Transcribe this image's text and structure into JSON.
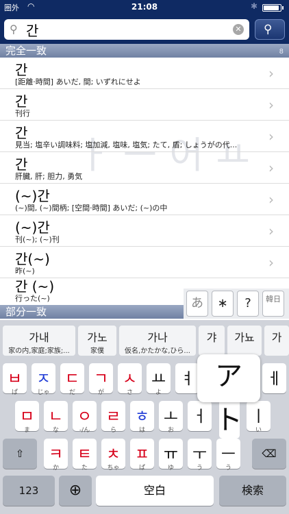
{
  "status": {
    "carrier": "圏外",
    "time": "21:08"
  },
  "search": {
    "value": "간"
  },
  "exact_section": {
    "label": "完全一致",
    "count": "8"
  },
  "partial_section": {
    "label": "部分一致"
  },
  "watermark": "ㅏㅡ어ㅛ",
  "results": [
    {
      "title": "간",
      "sub": "[距離·時間] あいだ, 間; いずれにせよ"
    },
    {
      "title": "간",
      "sub": "刊行"
    },
    {
      "title": "간",
      "sub": "見当; 塩辛い調味料; 塩加減, 塩味, 塩気; たて, 盾; しょうがの代..."
    },
    {
      "title": "간",
      "sub": "肝臓, 肝; 胆力, 勇気"
    },
    {
      "title": "(~)간",
      "sub": "(~)間, (~)間柄; [空間·時間] あいだ; (~)の中"
    },
    {
      "title": "(~)간",
      "sub": "刊(~); (~)刊"
    },
    {
      "title": "간(~)",
      "sub": "昨(~)"
    },
    {
      "title": "간 (~)",
      "sub": "行った(~)"
    }
  ],
  "candidates": [
    {
      "main": "가내",
      "sub": "家の内,家庭;家族;..."
    },
    {
      "main": "가노",
      "sub": "家僕"
    },
    {
      "main": "가나",
      "sub": "仮名,かたかな,ひら..."
    },
    {
      "main": "갸",
      "sub": ""
    },
    {
      "main": "가뇨",
      "sub": ""
    },
    {
      "main": "가",
      "sub": ""
    }
  ],
  "popup": {
    "a": "あ",
    "star": "∗",
    "q": "?",
    "hanja": "韓日",
    "big": "ア ト"
  },
  "keys": {
    "row1": [
      {
        "main": "ㅂ",
        "sub": "ぱ"
      },
      {
        "main": "ㅈ",
        "sub": "じゃ"
      },
      {
        "main": "ㄷ",
        "sub": "だ"
      },
      {
        "main": "ㄱ",
        "sub": "が"
      },
      {
        "main": "ㅅ",
        "sub": "さ"
      },
      {
        "main": "ㅛ",
        "sub": "よ"
      },
      {
        "main": "ㅕ",
        "sub": ""
      },
      {
        "main": "ㅔ",
        "sub": ""
      }
    ],
    "row2": [
      {
        "main": "ㅁ",
        "sub": "ま"
      },
      {
        "main": "ㄴ",
        "sub": "な"
      },
      {
        "main": "ㅇ",
        "sub": "-/ん"
      },
      {
        "main": "ㄹ",
        "sub": "ら"
      },
      {
        "main": "ㅎ",
        "sub": "は"
      },
      {
        "main": "ㅗ",
        "sub": "お"
      },
      {
        "main": "ㅓ",
        "sub": ""
      },
      {
        "main": "ㅣ",
        "sub": "い"
      }
    ],
    "row3": [
      {
        "main": "ㅋ",
        "sub": "か"
      },
      {
        "main": "ㅌ",
        "sub": "た"
      },
      {
        "main": "ㅊ",
        "sub": "ちゃ"
      },
      {
        "main": "ㅍ",
        "sub": "ぱ"
      },
      {
        "main": "ㅠ",
        "sub": "ゆ"
      },
      {
        "main": "ㅜ",
        "sub": "う"
      },
      {
        "main": "ㅡ",
        "sub": "う"
      }
    ],
    "num": "123",
    "space": "空白",
    "search": "検索"
  },
  "colors": {
    "header": "#0f2a63",
    "key_red": "#d7001a",
    "key_blue": "#1f3bd6"
  },
  "battery_level": 0.9
}
